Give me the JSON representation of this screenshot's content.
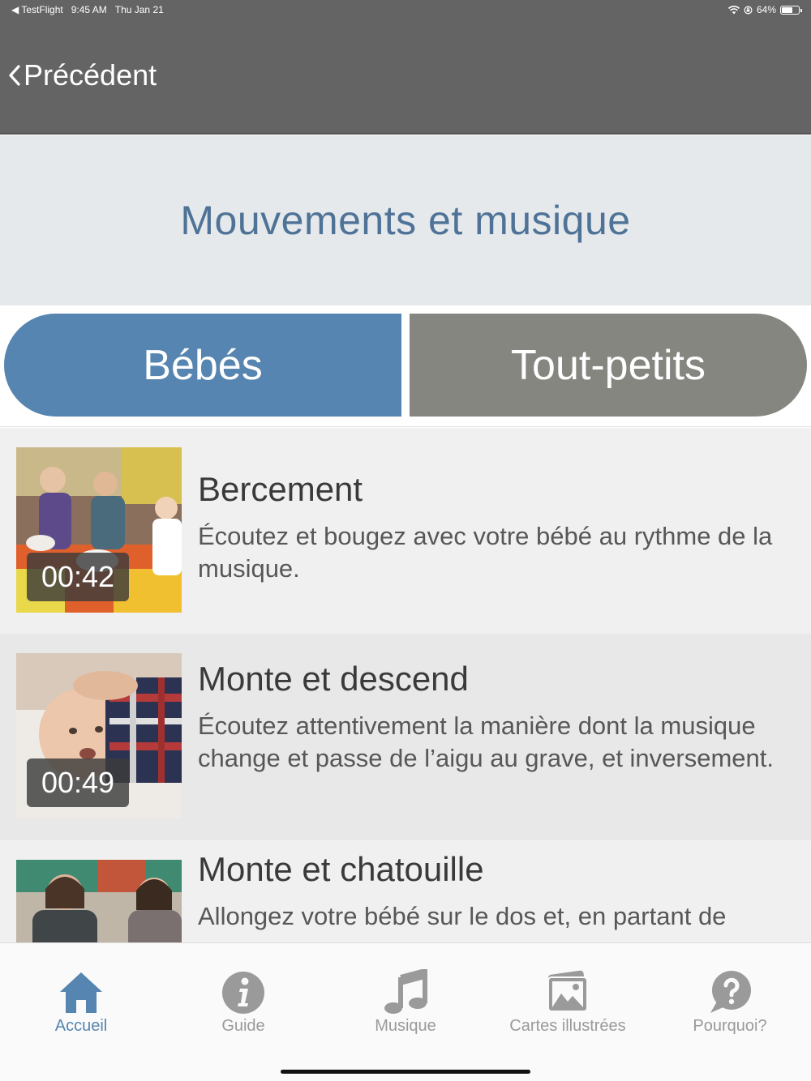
{
  "status_bar": {
    "back_app": "TestFlight",
    "time": "9:45 AM",
    "date": "Thu Jan 21",
    "battery": "64%",
    "battery_level": 0.64
  },
  "nav": {
    "back_label": "Précédent"
  },
  "header": {
    "title": "Mouvements et musique"
  },
  "segments": {
    "babies": "Bébés",
    "toddlers": "Tout-petits",
    "selected": "babies"
  },
  "videos": [
    {
      "duration": "00:42",
      "title": "Bercement",
      "description": "Écoutez et bougez avec votre bébé au rythme de la musique."
    },
    {
      "duration": "00:49",
      "title": "Monte et descend",
      "description": "Écoutez attentivement la manière dont la musique change et passe de l’aigu au grave, et inversement."
    },
    {
      "duration": "",
      "title": "Monte et chatouille",
      "description": "Allongez votre bébé sur le dos et, en partant de"
    }
  ],
  "tab_bar": {
    "items": [
      {
        "label": "Accueil",
        "icon": "home-icon",
        "active": true
      },
      {
        "label": "Guide",
        "icon": "info-icon",
        "active": false
      },
      {
        "label": "Musique",
        "icon": "music-note-icon",
        "active": false
      },
      {
        "label": "Cartes illustrées",
        "icon": "picture-cards-icon",
        "active": false
      },
      {
        "label": "Pourquoi?",
        "icon": "question-bubble-icon",
        "active": false
      }
    ]
  },
  "colors": {
    "nav_bg": "#646464",
    "title_text": "#4f7397",
    "accent_blue": "#5585b0",
    "segment_inactive": "#868681",
    "tab_inactive": "#9a9a9a"
  }
}
